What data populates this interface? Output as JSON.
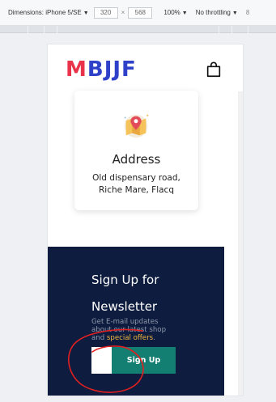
{
  "devtools": {
    "dimensions_label": "Dimensions: iPhone 5/SE",
    "width": "320",
    "times": "×",
    "height": "568",
    "zoom": "100%",
    "throttling": "No throttling",
    "overflow_glyph": "8"
  },
  "header": {
    "logo_first": "M",
    "logo_rest": "BJJF",
    "cart_icon": "shopping-bag-icon"
  },
  "address": {
    "icon": "map-pin-icon",
    "title": "Address",
    "line1": "Old dispensary road,",
    "line2": "Riche Mare, Flacq"
  },
  "newsletter": {
    "title_line1": "Sign Up for",
    "title_line2": "Newsletter",
    "desc_line1": "Get E-mail updates",
    "desc_line2": "about our latest shop",
    "desc_line3_prefix": "and ",
    "desc_line3_highlight": "special offers",
    "desc_line3_suffix": ".",
    "email_value": "",
    "signup_label": "Sign Up"
  },
  "colors": {
    "logo_m": "#e8334a",
    "logo_rest": "#2f41c9",
    "newsletter_bg": "#0e1d3f",
    "signup_bg": "#137f72",
    "highlight": "#f0b43c",
    "annotation": "#e02020"
  }
}
